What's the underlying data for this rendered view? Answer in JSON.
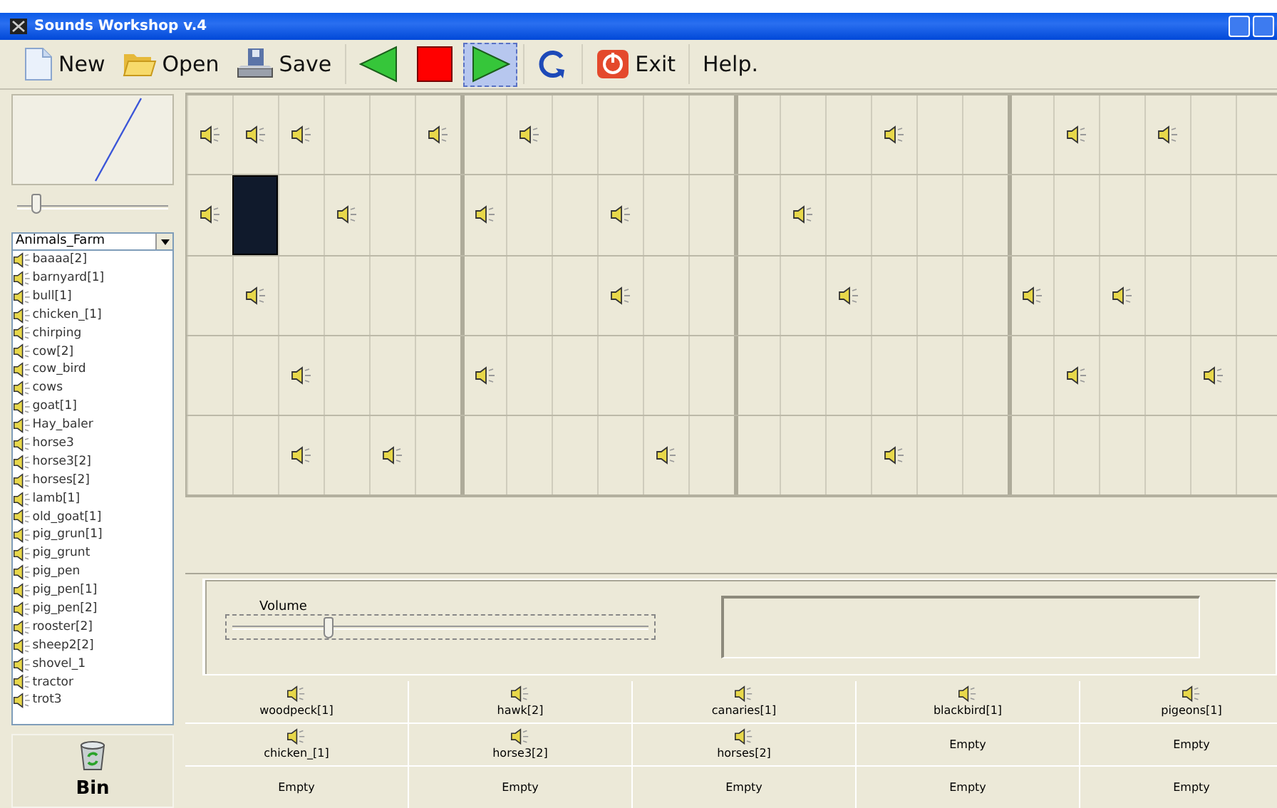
{
  "window": {
    "title": "Sounds Workshop v.4"
  },
  "toolbar": [
    {
      "kind": "new",
      "label": "New",
      "pressed": false
    },
    {
      "kind": "open",
      "label": "Open",
      "pressed": false
    },
    {
      "kind": "save",
      "label": "Save",
      "pressed": false
    },
    {
      "kind": "back",
      "pressed": false
    },
    {
      "kind": "stop",
      "pressed": false
    },
    {
      "kind": "play",
      "pressed": true
    },
    {
      "kind": "loop",
      "pressed": false
    },
    {
      "kind": "exit",
      "label": "Exit",
      "pressed": false
    },
    {
      "kind": "help",
      "label": "Help.",
      "pressed": false
    }
  ],
  "sidebar": {
    "slider": {
      "level": 0.1
    },
    "category": "Animals_Farm",
    "sounds": [
      "baaaa[2]",
      "barnyard[1]",
      "bull[1]",
      "chicken_[1]",
      "chirping",
      "cow[2]",
      "cow_bird",
      "cows",
      "goat[1]",
      "Hay_baler",
      "horse3",
      "horse3[2]",
      "horses[2]",
      "lamb[1]",
      "old_goat[1]",
      "pig_grun[1]",
      "pig_grunt",
      "pig_pen",
      "pig_pen[1]",
      "pig_pen[2]",
      "rooster[2]",
      "sheep2[2]",
      "shovel_1",
      "tractor",
      "trot3"
    ],
    "bin": {
      "label": "Bin"
    }
  },
  "grid": {
    "rows": [
      {
        "cells": [
          {
            "kind": "sound",
            "selected": false
          },
          {
            "kind": "sound",
            "selected": false
          },
          {
            "kind": "sound",
            "selected": false
          },
          {
            "kind": "empty",
            "selected": false
          },
          {
            "kind": "empty",
            "selected": false
          },
          {
            "kind": "sound",
            "selected": false
          },
          {
            "kind": "empty",
            "selected": false
          },
          {
            "kind": "sound",
            "selected": false
          },
          {
            "kind": "empty",
            "selected": false
          },
          {
            "kind": "empty",
            "selected": false
          },
          {
            "kind": "empty",
            "selected": false
          },
          {
            "kind": "empty",
            "selected": false
          },
          {
            "kind": "empty",
            "selected": false
          },
          {
            "kind": "empty",
            "selected": false
          },
          {
            "kind": "empty",
            "selected": false
          },
          {
            "kind": "sound",
            "selected": false
          },
          {
            "kind": "empty",
            "selected": false
          },
          {
            "kind": "empty",
            "selected": false
          },
          {
            "kind": "empty",
            "selected": false
          },
          {
            "kind": "sound",
            "selected": false
          },
          {
            "kind": "empty",
            "selected": false
          },
          {
            "kind": "sound",
            "selected": false
          },
          {
            "kind": "empty",
            "selected": false
          },
          {
            "kind": "empty",
            "selected": false
          }
        ]
      },
      {
        "cells": [
          {
            "kind": "sound",
            "selected": false
          },
          {
            "kind": "empty",
            "selected": true
          },
          {
            "kind": "empty",
            "selected": false
          },
          {
            "kind": "sound",
            "selected": false
          },
          {
            "kind": "empty",
            "selected": false
          },
          {
            "kind": "empty",
            "selected": false
          },
          {
            "kind": "sound",
            "selected": false
          },
          {
            "kind": "empty",
            "selected": false
          },
          {
            "kind": "empty",
            "selected": false
          },
          {
            "kind": "sound",
            "selected": false
          },
          {
            "kind": "empty",
            "selected": false
          },
          {
            "kind": "empty",
            "selected": false
          },
          {
            "kind": "empty",
            "selected": false
          },
          {
            "kind": "sound",
            "selected": false
          },
          {
            "kind": "empty",
            "selected": false
          },
          {
            "kind": "empty",
            "selected": false
          },
          {
            "kind": "empty",
            "selected": false
          },
          {
            "kind": "empty",
            "selected": false
          },
          {
            "kind": "empty",
            "selected": false
          },
          {
            "kind": "empty",
            "selected": false
          },
          {
            "kind": "empty",
            "selected": false
          },
          {
            "kind": "empty",
            "selected": false
          },
          {
            "kind": "empty",
            "selected": false
          },
          {
            "kind": "empty",
            "selected": false
          }
        ]
      },
      {
        "cells": [
          {
            "kind": "empty",
            "selected": false
          },
          {
            "kind": "sound",
            "selected": false
          },
          {
            "kind": "empty",
            "selected": false
          },
          {
            "kind": "empty",
            "selected": false
          },
          {
            "kind": "empty",
            "selected": false
          },
          {
            "kind": "empty",
            "selected": false
          },
          {
            "kind": "empty",
            "selected": false
          },
          {
            "kind": "empty",
            "selected": false
          },
          {
            "kind": "empty",
            "selected": false
          },
          {
            "kind": "sound",
            "selected": false
          },
          {
            "kind": "empty",
            "selected": false
          },
          {
            "kind": "empty",
            "selected": false
          },
          {
            "kind": "empty",
            "selected": false
          },
          {
            "kind": "empty",
            "selected": false
          },
          {
            "kind": "sound",
            "selected": false
          },
          {
            "kind": "empty",
            "selected": false
          },
          {
            "kind": "empty",
            "selected": false
          },
          {
            "kind": "empty",
            "selected": false
          },
          {
            "kind": "sound",
            "selected": false
          },
          {
            "kind": "empty",
            "selected": false
          },
          {
            "kind": "sound",
            "selected": false
          },
          {
            "kind": "empty",
            "selected": false
          },
          {
            "kind": "empty",
            "selected": false
          },
          {
            "kind": "empty",
            "selected": false
          }
        ]
      },
      {
        "cells": [
          {
            "kind": "empty",
            "selected": false
          },
          {
            "kind": "empty",
            "selected": false
          },
          {
            "kind": "sound",
            "selected": false
          },
          {
            "kind": "empty",
            "selected": false
          },
          {
            "kind": "empty",
            "selected": false
          },
          {
            "kind": "empty",
            "selected": false
          },
          {
            "kind": "sound",
            "selected": false
          },
          {
            "kind": "empty",
            "selected": false
          },
          {
            "kind": "empty",
            "selected": false
          },
          {
            "kind": "empty",
            "selected": false
          },
          {
            "kind": "empty",
            "selected": false
          },
          {
            "kind": "empty",
            "selected": false
          },
          {
            "kind": "empty",
            "selected": false
          },
          {
            "kind": "empty",
            "selected": false
          },
          {
            "kind": "empty",
            "selected": false
          },
          {
            "kind": "empty",
            "selected": false
          },
          {
            "kind": "empty",
            "selected": false
          },
          {
            "kind": "empty",
            "selected": false
          },
          {
            "kind": "empty",
            "selected": false
          },
          {
            "kind": "sound",
            "selected": false
          },
          {
            "kind": "empty",
            "selected": false
          },
          {
            "kind": "empty",
            "selected": false
          },
          {
            "kind": "sound",
            "selected": false
          },
          {
            "kind": "empty",
            "selected": false
          }
        ]
      },
      {
        "cells": [
          {
            "kind": "empty",
            "selected": false
          },
          {
            "kind": "empty",
            "selected": false
          },
          {
            "kind": "sound",
            "selected": false
          },
          {
            "kind": "empty",
            "selected": false
          },
          {
            "kind": "sound",
            "selected": false
          },
          {
            "kind": "empty",
            "selected": false
          },
          {
            "kind": "empty",
            "selected": false
          },
          {
            "kind": "empty",
            "selected": false
          },
          {
            "kind": "empty",
            "selected": false
          },
          {
            "kind": "empty",
            "selected": false
          },
          {
            "kind": "sound",
            "selected": false
          },
          {
            "kind": "empty",
            "selected": false
          },
          {
            "kind": "empty",
            "selected": false
          },
          {
            "kind": "empty",
            "selected": false
          },
          {
            "kind": "empty",
            "selected": false
          },
          {
            "kind": "sound",
            "selected": false
          },
          {
            "kind": "empty",
            "selected": false
          },
          {
            "kind": "empty",
            "selected": false
          },
          {
            "kind": "empty",
            "selected": false
          },
          {
            "kind": "empty",
            "selected": false
          },
          {
            "kind": "empty",
            "selected": false
          },
          {
            "kind": "empty",
            "selected": false
          },
          {
            "kind": "empty",
            "selected": false
          },
          {
            "kind": "empty",
            "selected": false
          }
        ]
      }
    ]
  },
  "volume": {
    "label": "Volume",
    "level": 0.22
  },
  "slots": [
    {
      "kind": "sound",
      "label": "woodpeck[1]"
    },
    {
      "kind": "sound",
      "label": "hawk[2]"
    },
    {
      "kind": "sound",
      "label": "canaries[1]"
    },
    {
      "kind": "sound",
      "label": "blackbird[1]"
    },
    {
      "kind": "sound",
      "label": "pigeons[1]"
    },
    {
      "kind": "sound",
      "label": "chicken_[1]"
    },
    {
      "kind": "sound",
      "label": "horse3[2]"
    },
    {
      "kind": "sound",
      "label": "horses[2]"
    },
    {
      "kind": "empty",
      "label": "Empty"
    },
    {
      "kind": "empty",
      "label": "Empty"
    },
    {
      "kind": "empty",
      "label": "Empty"
    },
    {
      "kind": "empty",
      "label": "Empty"
    },
    {
      "kind": "empty",
      "label": "Empty"
    },
    {
      "kind": "empty",
      "label": "Empty"
    },
    {
      "kind": "empty",
      "label": "Empty"
    }
  ]
}
